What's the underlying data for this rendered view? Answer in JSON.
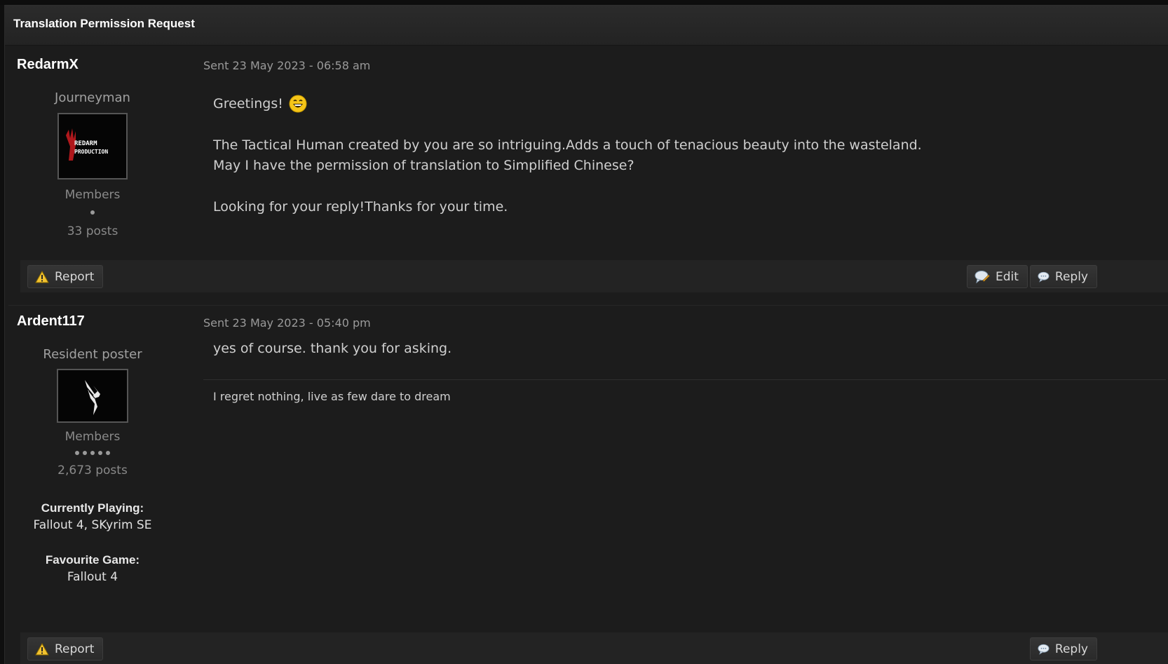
{
  "thread": {
    "title": "Translation Permission Request"
  },
  "posts": [
    {
      "author": "RedarmX",
      "date": "Sent 23 May 2023 - 06:58 am",
      "rank": "Journeyman",
      "avatar_text": [
        "REDARM",
        "PRODUCTION"
      ],
      "group": "Members",
      "pips": 1,
      "post_count": "33 posts",
      "message": {
        "greeting": "Greetings!",
        "line1": "The Tactical Human created by you are so intriguing.Adds a touch of tenacious beauty into the wasteland.",
        "line2": "May I have the permission of translation to Simplified Chinese?",
        "line3": "Looking for your reply!Thanks for your time."
      },
      "buttons": {
        "report": "Report",
        "edit": "Edit",
        "reply": "Reply"
      }
    },
    {
      "author": "Ardent117",
      "date": "Sent 23 May 2023 - 05:40 pm",
      "rank": "Resident poster",
      "group": "Members",
      "pips": 5,
      "post_count": "2,673 posts",
      "fields": [
        {
          "label": "Currently Playing:",
          "value": "Fallout 4, SKyrim SE"
        },
        {
          "label": "Favourite Game:",
          "value": "Fallout 4"
        }
      ],
      "message": {
        "line1": "yes of course. thank you for asking."
      },
      "signature": "I regret nothing, live as few dare to dream",
      "buttons": {
        "report": "Report",
        "reply": "Reply"
      }
    }
  ],
  "icons": {
    "report": "warning-triangle-icon",
    "edit": "edit-bubble-icon",
    "reply": "speech-bubble-icon",
    "emoji": "grin-emoji-icon"
  },
  "colors": {
    "background": "#1c1c1c",
    "header": "#2b2b2b",
    "warning": "#f2c230",
    "emoji": "#f5c518"
  }
}
